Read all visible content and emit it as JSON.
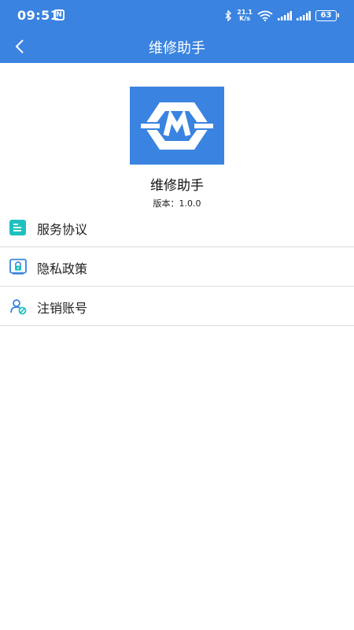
{
  "status_bar": {
    "time": "09:51",
    "nfc": "N",
    "speed_value": "21.1",
    "speed_unit": "K/s",
    "battery": "63"
  },
  "nav": {
    "title": "维修助手"
  },
  "app": {
    "name": "维修助手",
    "version": "版本：1.0.0",
    "logo_letter": "M"
  },
  "menu": [
    {
      "label": "服务协议",
      "icon": "document-list-icon"
    },
    {
      "label": "隐私政策",
      "icon": "privacy-lock-icon"
    },
    {
      "label": "注销账号",
      "icon": "user-cancel-icon"
    }
  ],
  "colors": {
    "primary": "#3a83e0",
    "divider": "#dcdcdc",
    "icon_teal": "#1fc0c0",
    "icon_blue": "#3a83e0"
  }
}
